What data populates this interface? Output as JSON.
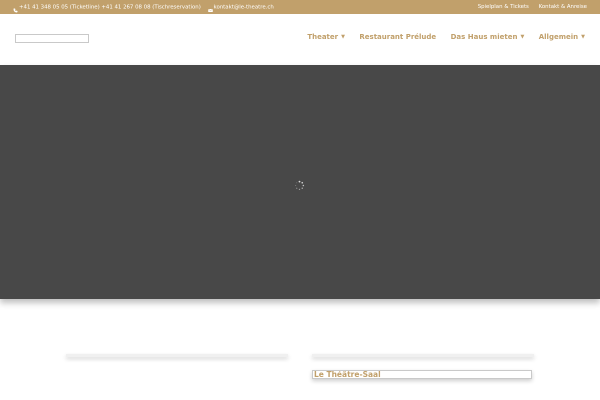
{
  "topbar": {
    "phone_text": "+41 41 348 05 05 (Ticketline) +41 41 267 08 08 (Tischreservation)",
    "email_text": "kontakt@le-theatre.ch",
    "links": [
      "Spielplan & Tickets",
      "Kontakt & Anreise"
    ],
    "phone_icon": "phone-icon",
    "mail_icon": "mail-icon"
  },
  "nav": {
    "items": [
      {
        "label": "Theater",
        "has_dropdown": true
      },
      {
        "label": "Restaurant Prélude",
        "has_dropdown": false
      },
      {
        "label": "Das Haus mieten",
        "has_dropdown": true
      },
      {
        "label": "Allgemein",
        "has_dropdown": true
      }
    ]
  },
  "content": {
    "section_title": "Le Théâtre-Saal"
  },
  "colors": {
    "accent": "#c1a06b",
    "hero_bg": "#484848"
  }
}
